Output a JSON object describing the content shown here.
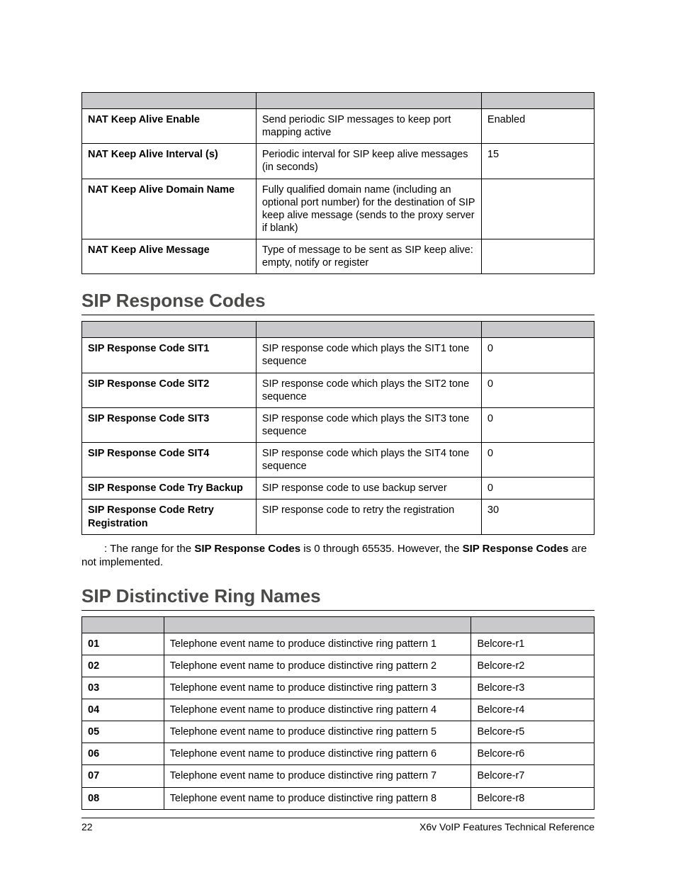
{
  "table1": {
    "rows": [
      {
        "param": "NAT Keep Alive Enable",
        "desc": "Send periodic SIP messages to keep port mapping active",
        "val": "Enabled"
      },
      {
        "param": "NAT Keep Alive Interval (s)",
        "desc": "Periodic interval for SIP keep alive messages (in seconds)",
        "val": "15"
      },
      {
        "param": "NAT Keep Alive Domain Name",
        "desc": "Fully qualified domain name (including an optional port number) for the destination of SIP keep alive message (sends to the proxy server if blank)",
        "val": ""
      },
      {
        "param": "NAT Keep Alive Message",
        "desc": "Type of message to be sent as SIP keep alive: empty, notify or register",
        "val": ""
      }
    ]
  },
  "heading2": "SIP Response Codes",
  "table2": {
    "rows": [
      {
        "param": "SIP Response Code SIT1",
        "desc": "SIP response code which plays the SIT1 tone sequence",
        "val": "0"
      },
      {
        "param": "SIP Response Code SIT2",
        "desc": "SIP response code which plays the SIT2 tone sequence",
        "val": "0"
      },
      {
        "param": "SIP Response Code SIT3",
        "desc": "SIP response code which plays the SIT3 tone sequence",
        "val": "0"
      },
      {
        "param": "SIP Response Code SIT4",
        "desc": "SIP response code which plays the SIT4 tone sequence",
        "val": "0"
      },
      {
        "param": "SIP Response Code Try Backup",
        "desc": "SIP response code to use backup server",
        "val": "0"
      },
      {
        "param": "SIP Response Code Retry Registration",
        "desc": "SIP response code to retry the registration",
        "val": "30"
      }
    ]
  },
  "note": {
    "prefix": ": The range for the ",
    "bold1": "SIP Response Codes",
    "mid": " is 0 through 65535. However, the ",
    "bold2": "SIP Response Codes",
    "suffix": " are not implemented."
  },
  "heading3": "SIP Distinctive Ring Names",
  "table3": {
    "rows": [
      {
        "param": "01",
        "desc": "Telephone event name to produce distinctive ring pattern 1",
        "val": "Belcore-r1"
      },
      {
        "param": "02",
        "desc": "Telephone event name to produce distinctive ring pattern 2",
        "val": "Belcore-r2"
      },
      {
        "param": "03",
        "desc": "Telephone event name to produce distinctive ring pattern 3",
        "val": "Belcore-r3"
      },
      {
        "param": "04",
        "desc": "Telephone event name to produce distinctive ring pattern 4",
        "val": "Belcore-r4"
      },
      {
        "param": "05",
        "desc": "Telephone event name to produce distinctive ring pattern 5",
        "val": "Belcore-r5"
      },
      {
        "param": "06",
        "desc": "Telephone event name to produce distinctive ring pattern 6",
        "val": "Belcore-r6"
      },
      {
        "param": "07",
        "desc": "Telephone event name to produce distinctive ring pattern 7",
        "val": "Belcore-r7"
      },
      {
        "param": "08",
        "desc": "Telephone event name to produce distinctive ring pattern 8",
        "val": "Belcore-r8"
      }
    ]
  },
  "footer": {
    "page": "22",
    "title": "X6v VoIP Features Technical Reference"
  }
}
